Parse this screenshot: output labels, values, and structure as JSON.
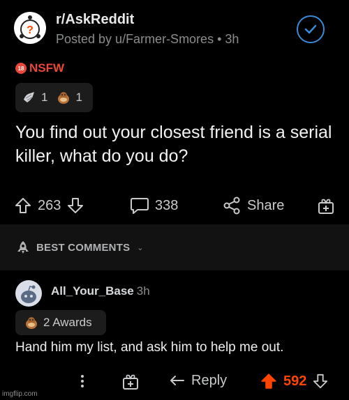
{
  "post": {
    "subreddit": "r/AskReddit",
    "posted_by": "Posted by u/Farmer-Smores • 3h",
    "nsfw_badge": "18",
    "nsfw_label": "NSFW",
    "awards": [
      {
        "icon": "silver-award-icon",
        "count": "1"
      },
      {
        "icon": "wholesome-award-icon",
        "count": "1"
      }
    ],
    "title": "You find out your closest friend is a serial killer, what do you do?",
    "upvotes": "263",
    "comments": "338",
    "share_label": "Share"
  },
  "sort": {
    "label": "BEST COMMENTS"
  },
  "comment": {
    "username": "All_Your_Base",
    "time": "3h",
    "awards_label": "2 Awards",
    "body": "Hand him my list, and ask him to help me out.",
    "reply_label": "Reply",
    "score": "592"
  },
  "watermark": "imgflip.com",
  "colors": {
    "background": "#000000",
    "upvote_active": "#ff4500",
    "nsfw": "#e8473a",
    "joined": "#3a8ad8"
  }
}
